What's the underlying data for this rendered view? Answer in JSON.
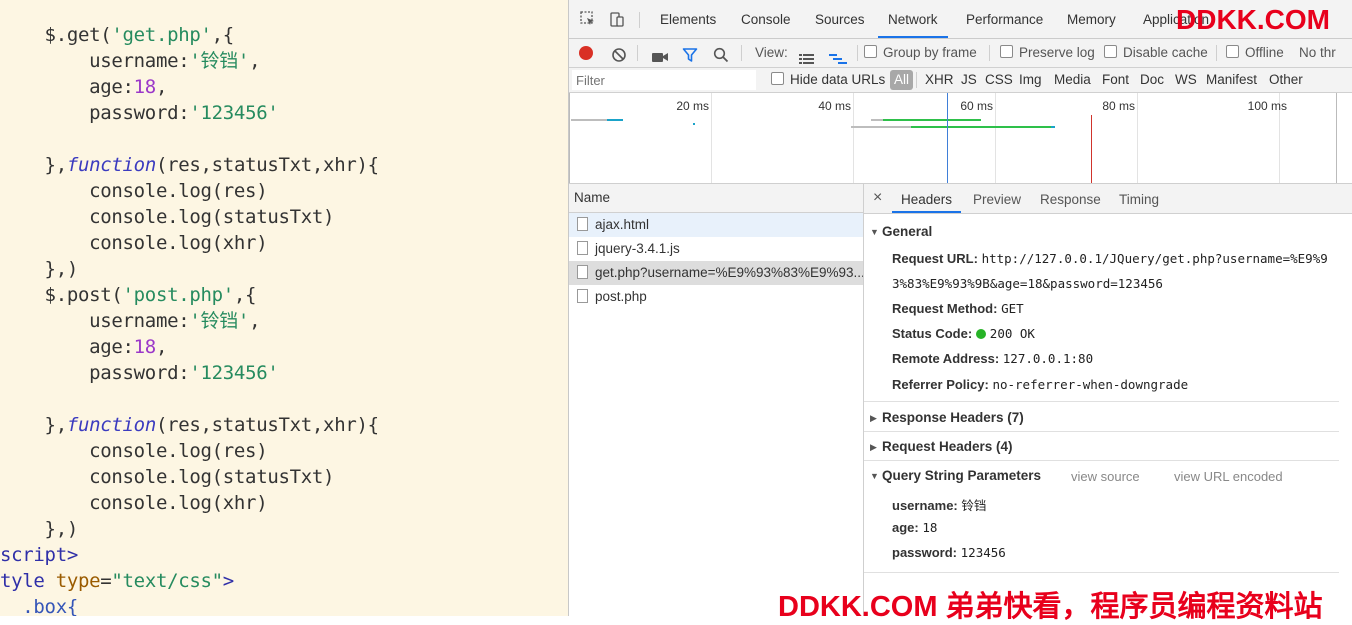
{
  "editor": {
    "lines": [
      [
        {
          "t": "    $.get(",
          "c": ""
        },
        {
          "t": "'get.php'",
          "c": "str"
        },
        {
          "t": ",{",
          "c": ""
        }
      ],
      [
        {
          "t": "        username:",
          "c": ""
        },
        {
          "t": "'铃铛'",
          "c": "str"
        },
        {
          "t": ",",
          "c": ""
        }
      ],
      [
        {
          "t": "        age:",
          "c": ""
        },
        {
          "t": "18",
          "c": "num"
        },
        {
          "t": ",",
          "c": ""
        }
      ],
      [
        {
          "t": "        password:",
          "c": ""
        },
        {
          "t": "'123456'",
          "c": "str"
        }
      ],
      [],
      [
        {
          "t": "    },",
          "c": ""
        },
        {
          "t": "function",
          "c": "kw"
        },
        {
          "t": "(res,statusTxt,xhr){",
          "c": ""
        }
      ],
      [
        {
          "t": "        console.log(res)",
          "c": ""
        }
      ],
      [
        {
          "t": "        console.log(statusTxt)",
          "c": ""
        }
      ],
      [
        {
          "t": "        console.log(xhr)",
          "c": ""
        }
      ],
      [
        {
          "t": "    },)",
          "c": ""
        }
      ],
      [
        {
          "t": "    $.post(",
          "c": ""
        },
        {
          "t": "'post.php'",
          "c": "str"
        },
        {
          "t": ",{",
          "c": ""
        }
      ],
      [
        {
          "t": "        username:",
          "c": ""
        },
        {
          "t": "'铃铛'",
          "c": "str"
        },
        {
          "t": ",",
          "c": ""
        }
      ],
      [
        {
          "t": "        age:",
          "c": ""
        },
        {
          "t": "18",
          "c": "num"
        },
        {
          "t": ",",
          "c": ""
        }
      ],
      [
        {
          "t": "        password:",
          "c": ""
        },
        {
          "t": "'123456'",
          "c": "str"
        }
      ],
      [],
      [
        {
          "t": "    },",
          "c": ""
        },
        {
          "t": "function",
          "c": "kw"
        },
        {
          "t": "(res,statusTxt,xhr){",
          "c": ""
        }
      ],
      [
        {
          "t": "        console.log(res)",
          "c": ""
        }
      ],
      [
        {
          "t": "        console.log(statusTxt)",
          "c": ""
        }
      ],
      [
        {
          "t": "        console.log(xhr)",
          "c": ""
        }
      ],
      [
        {
          "t": "    },)",
          "c": ""
        }
      ],
      [
        {
          "t": "script>",
          "c": "tag"
        }
      ],
      [
        {
          "t": "tyle ",
          "c": "tag"
        },
        {
          "t": "type",
          "c": "attr"
        },
        {
          "t": "=",
          "c": ""
        },
        {
          "t": "\"text/css\"",
          "c": "str"
        },
        {
          "t": ">",
          "c": "tag"
        }
      ],
      [
        {
          "t": "  .box{",
          "c": "blue"
        }
      ]
    ]
  },
  "devtools": {
    "tabs": [
      "Elements",
      "Console",
      "Sources",
      "Network",
      "Performance",
      "Memory",
      "Application"
    ],
    "active_tab": "Network",
    "controls": {
      "view_label": "View:",
      "group_by_frame": "Group by frame",
      "preserve_log": "Preserve log",
      "disable_cache": "Disable cache",
      "offline": "Offline",
      "throttle": "No thr"
    },
    "filter": {
      "placeholder": "Filter",
      "hide_data_urls": "Hide data URLs",
      "types": [
        "All",
        "XHR",
        "JS",
        "CSS",
        "Img",
        "Media",
        "Font",
        "Doc",
        "WS",
        "Manifest",
        "Other"
      ]
    },
    "timeline": {
      "ticks": [
        "20 ms",
        "40 ms",
        "60 ms",
        "80 ms",
        "100 ms"
      ]
    },
    "requests": {
      "header": "Name",
      "rows": [
        "ajax.html",
        "jquery-3.4.1.js",
        "get.php?username=%E9%93%83%E9%93...",
        "post.php"
      ]
    },
    "details": {
      "close": "×",
      "tabs": [
        "Headers",
        "Preview",
        "Response",
        "Timing"
      ],
      "general": {
        "title": "General",
        "request_url_label": "Request URL:",
        "request_url_line1": "http://127.0.0.1/JQuery/get.php?username=%E9%9",
        "request_url_line2": "3%83%E9%93%9B&age=18&password=123456",
        "method_label": "Request Method:",
        "method": "GET",
        "status_label": "Status Code:",
        "status": "200 OK",
        "remote_label": "Remote Address:",
        "remote": "127.0.0.1:80",
        "referrer_label": "Referrer Policy:",
        "referrer": "no-referrer-when-downgrade"
      },
      "response_headers": "Response Headers (7)",
      "request_headers": "Request Headers (4)",
      "query": {
        "title": "Query String Parameters",
        "view_source": "view source",
        "view_url_encoded": "view URL encoded",
        "params": [
          {
            "k": "username:",
            "v": "铃铛"
          },
          {
            "k": "age:",
            "v": "18"
          },
          {
            "k": "password:",
            "v": "123456"
          }
        ]
      }
    }
  },
  "watermark": {
    "top": "DDKK.COM",
    "bottom": "DDKK.COM 弟弟快看，程序员编程资料站"
  }
}
